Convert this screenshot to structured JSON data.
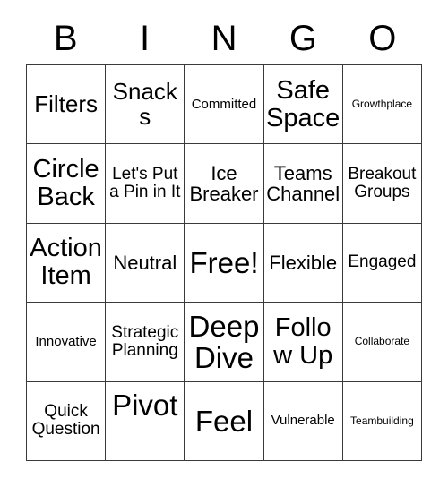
{
  "card": {
    "title": "BINGO",
    "header_letters": [
      "B",
      "I",
      "N",
      "G",
      "O"
    ],
    "colors": {
      "text": "#000000",
      "border": "#3a3a3a",
      "background": "#ffffff"
    },
    "rows": 5,
    "columns": 5,
    "cells": [
      [
        {
          "text": "Filters",
          "size": "xl"
        },
        {
          "text": "Snacks",
          "size": "xl"
        },
        {
          "text": "Committed",
          "size": "sm"
        },
        {
          "text": "Safe Space",
          "size": "xxl"
        },
        {
          "text": "Growthplace",
          "size": "xs"
        }
      ],
      [
        {
          "text": "Circle Back",
          "size": "xxl"
        },
        {
          "text": "Let's Put a Pin in It",
          "size": "md"
        },
        {
          "text": "Ice Breaker",
          "size": "lg"
        },
        {
          "text": "Teams Channel",
          "size": "lg"
        },
        {
          "text": "Breakout Groups",
          "size": "md"
        }
      ],
      [
        {
          "text": "Action Item",
          "size": "xxl"
        },
        {
          "text": "Neutral",
          "size": "lg"
        },
        {
          "text": "Free!",
          "size": "huge"
        },
        {
          "text": "Flexible",
          "size": "lg"
        },
        {
          "text": "Engaged",
          "size": "md"
        }
      ],
      [
        {
          "text": "Innovative",
          "size": "sm"
        },
        {
          "text": "Strategic Planning",
          "size": "md"
        },
        {
          "text": "Deep Dive",
          "size": "huge"
        },
        {
          "text": "Follow Up",
          "size": "xxl"
        },
        {
          "text": "Collaborate",
          "size": "xs"
        }
      ],
      [
        {
          "text": "Quick Question",
          "size": "md"
        },
        {
          "text": "Pivot",
          "size": "huge",
          "align": "upper"
        },
        {
          "text": "Feel",
          "size": "huge"
        },
        {
          "text": "Vulnerable",
          "size": "sm"
        },
        {
          "text": "Teambuilding",
          "size": "xs"
        }
      ]
    ]
  }
}
